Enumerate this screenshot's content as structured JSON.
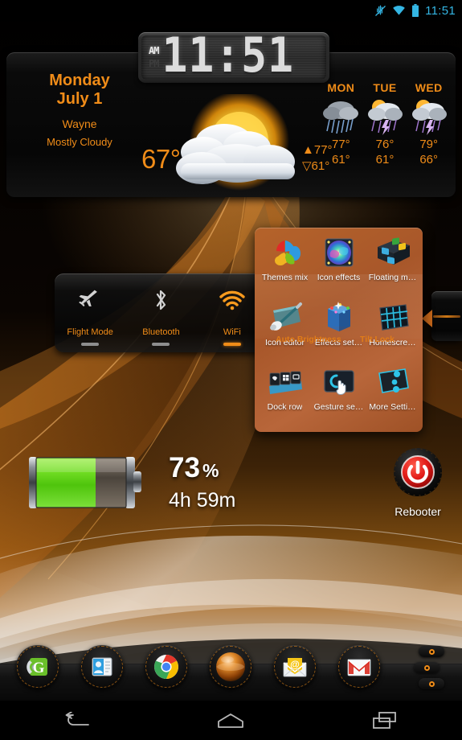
{
  "status_bar": {
    "icons": [
      "mute-icon",
      "wifi-icon",
      "battery-icon"
    ],
    "time": "11:51",
    "accent_color": "#34b6e4"
  },
  "clock_widget": {
    "am_label": "AM",
    "pm_label": "PM",
    "active_meridiem": "AM",
    "time": "11:51"
  },
  "weather_widget": {
    "day": "Monday",
    "date": "July 1",
    "city": "Wayne",
    "condition": "Mostly Cloudy",
    "current_temp": "67°",
    "high": "▲77°",
    "low": "▽61°",
    "accent_color": "#f08c18",
    "forecast": [
      {
        "day": "MON",
        "icon": "rain-icon",
        "high": "77°",
        "low": "61°"
      },
      {
        "day": "TUE",
        "icon": "storm-icon",
        "high": "76°",
        "low": "61°"
      },
      {
        "day": "WED",
        "icon": "storm-icon",
        "high": "79°",
        "low": "66°"
      }
    ]
  },
  "toggle_widget": {
    "toggles": [
      {
        "label": "Flight Mode",
        "icon": "airplane-icon",
        "state": "off"
      },
      {
        "label": "Bluetooth",
        "icon": "bluetooth-icon",
        "state": "off"
      },
      {
        "label": "WiFi",
        "icon": "wifi-icon",
        "state": "on"
      }
    ],
    "on_color": "#f08c18",
    "off_color": "#8e8e8e"
  },
  "settings_panel": {
    "background_color": "#b5632a",
    "items": [
      {
        "label": "Themes mix",
        "icon": "themes-mix-icon"
      },
      {
        "label": "Icon effects",
        "icon": "icon-effects-icon"
      },
      {
        "label": "Floating m…",
        "icon": "floating-menu-icon"
      },
      {
        "label": "Icon editor",
        "icon": "icon-editor-icon"
      },
      {
        "label": "Effects set…",
        "icon": "effects-settings-icon"
      },
      {
        "label": "Homescre…",
        "icon": "homescreen-icon"
      },
      {
        "label": "Dock row",
        "icon": "dock-row-icon"
      },
      {
        "label": "Gesture se…",
        "icon": "gesture-settings-icon"
      },
      {
        "label": "More Setti…",
        "icon": "more-settings-icon"
      }
    ],
    "behind_labels": [
      {
        "label": "Auto Brightness"
      },
      {
        "label": "Tilt Lock"
      }
    ]
  },
  "battery_widget": {
    "percent": "73",
    "percent_symbol": "%",
    "time_remaining": "4h 59m",
    "fill_ratio": 0.66,
    "fill_color": "#5fd41a"
  },
  "rebooter_widget": {
    "label": "Rebooter",
    "icon": "power-icon",
    "color": "#e11b18"
  },
  "dock": {
    "icons": [
      {
        "name": "google-voice-icon"
      },
      {
        "name": "contacts-icon"
      },
      {
        "name": "chrome-icon"
      },
      {
        "name": "app-drawer-icon"
      },
      {
        "name": "email-icon"
      },
      {
        "name": "gmail-icon"
      }
    ],
    "page_indicator_count": 3
  },
  "nav_bar": {
    "buttons": [
      {
        "name": "back-button",
        "icon": "back-arrow-icon"
      },
      {
        "name": "home-button",
        "icon": "home-icon"
      },
      {
        "name": "recents-button",
        "icon": "recents-icon"
      }
    ]
  }
}
